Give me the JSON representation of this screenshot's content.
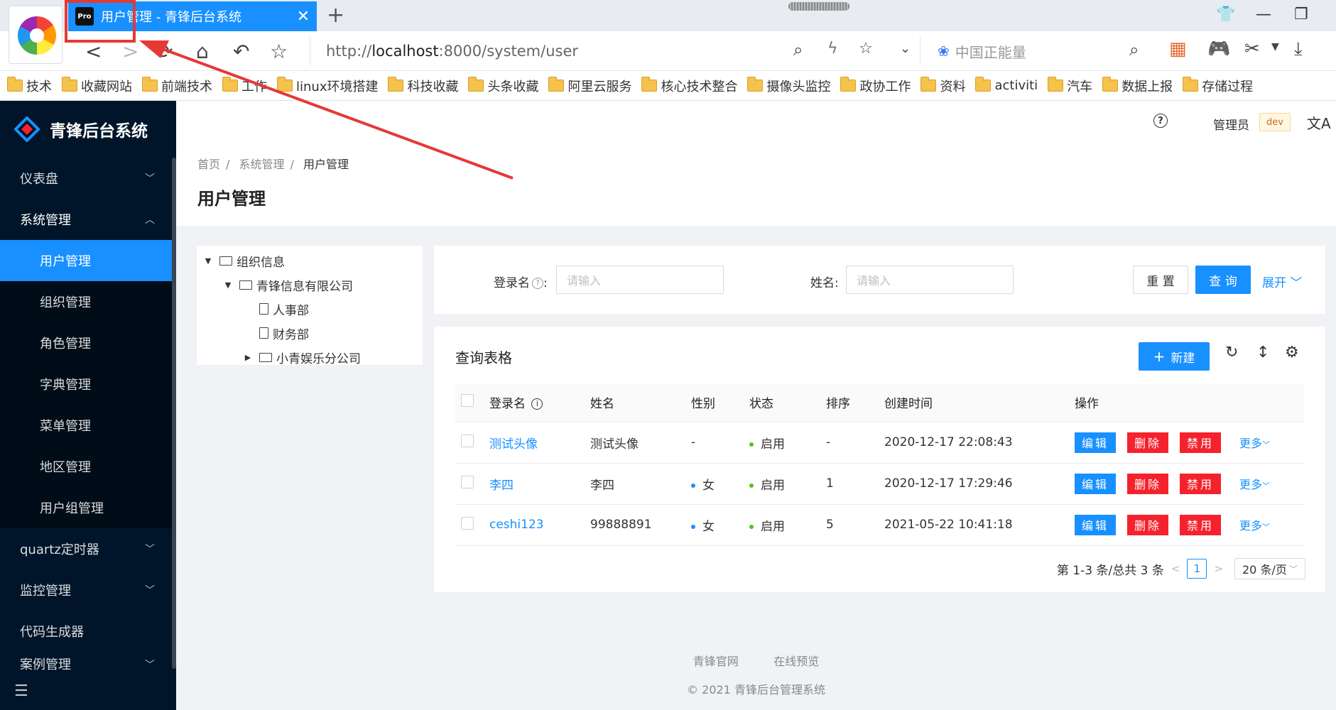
{
  "browser": {
    "tab_title": "用户管理 - 青锋后台系统",
    "tab_favicon": "Pro",
    "url_prefix": "http://",
    "url_host": "localhost",
    "url_rest": ":8000/system/user",
    "search_placeholder": "中国正能量",
    "bookmarks": [
      "技术",
      "收藏网站",
      "前端技术",
      "工作",
      "linux环境搭建",
      "科技收藏",
      "头条收藏",
      "阿里云服务",
      "核心技术整合",
      "摄像头监控",
      "政协工作",
      "资料",
      "activiti",
      "汽车",
      "数据上报",
      "存储过程"
    ]
  },
  "app": {
    "name": "青锋后台系统",
    "user_name": "管理员",
    "env_tag": "dev"
  },
  "sidebar": {
    "items": [
      {
        "label": "仪表盘"
      },
      {
        "label": "系统管理"
      },
      {
        "label": "quartz定时器"
      },
      {
        "label": "监控管理"
      },
      {
        "label": "代码生成器"
      },
      {
        "label": "案例管理"
      }
    ],
    "system_sub": [
      "用户管理",
      "组织管理",
      "角色管理",
      "字典管理",
      "菜单管理",
      "地区管理",
      "用户组管理"
    ]
  },
  "breadcrumb": [
    "首页",
    "系统管理",
    "用户管理"
  ],
  "page_title": "用户管理",
  "tree": {
    "root": "组织信息",
    "company": "青锋信息有限公司",
    "children": [
      "人事部",
      "财务部",
      "小青娱乐分公司"
    ]
  },
  "search": {
    "login_label": "登录名",
    "login_placeholder": "请输入",
    "name_label": "姓名:",
    "name_placeholder": "请输入",
    "reset": "重 置",
    "query": "查 询",
    "expand": "展开"
  },
  "table": {
    "title": "查询表格",
    "new_button": "新建",
    "headers": [
      "登录名",
      "姓名",
      "性别",
      "状态",
      "排序",
      "创建时间",
      "操作"
    ],
    "rows": [
      {
        "login": "测试头像",
        "name": "测试头像",
        "gender": "-",
        "status": "启用",
        "order": "-",
        "created": "2020-12-17 22:08:43"
      },
      {
        "login": "李四",
        "name": "李四",
        "gender": "女",
        "status": "启用",
        "order": "1",
        "created": "2020-12-17 17:29:46"
      },
      {
        "login": "ceshi123",
        "name": "99888891",
        "gender": "女",
        "status": "启用",
        "order": "5",
        "created": "2021-05-22 10:41:18"
      }
    ],
    "actions": {
      "edit": "编辑",
      "delete": "删除",
      "disable": "禁用",
      "more": "更多"
    },
    "pagination": {
      "summary": "第 1-3 条/总共 3 条",
      "page": "1",
      "page_size": "20 条/页"
    }
  },
  "footer": {
    "links": [
      "青锋官网",
      "在线预览"
    ],
    "copyright": "2021 青锋后台管理系统"
  },
  "colors": {
    "primary": "#1890ff",
    "sider": "#001529",
    "danger": "#f5222d",
    "annotation": "#e53935"
  }
}
